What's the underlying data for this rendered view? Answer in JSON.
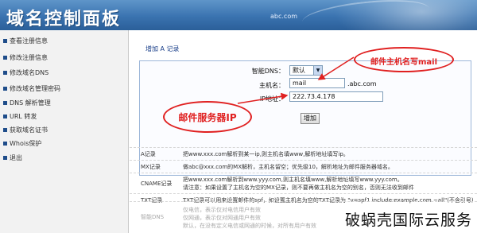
{
  "header": {
    "title": "域名控制面板",
    "site": "abc.com"
  },
  "sidebar": {
    "items": [
      {
        "label": "查看注册信息"
      },
      {
        "label": "修改注册信息"
      },
      {
        "label": "修改域名DNS"
      },
      {
        "label": "修改域名管理密码"
      },
      {
        "label": "DNS 解析管理"
      },
      {
        "label": "URL 转发"
      },
      {
        "label": "获取域名证书"
      },
      {
        "label": "Whois保护"
      },
      {
        "label": "退出"
      }
    ],
    "bullet_color": "#1f4d8a"
  },
  "main": {
    "tab_title": "增加 A 记录",
    "form": {
      "line_label": "智能DNS：",
      "line_value": "默认",
      "host_label": "主机名：",
      "host_value": "mail",
      "host_suffix": ".abc.com",
      "ip_label": "IP地址：",
      "ip_value": "222.73.4.178",
      "submit_label": "增加"
    },
    "annotations": {
      "host_note": "邮件主机名写mail",
      "ip_note": "邮件服务器IP",
      "color": "#e02020"
    },
    "records": [
      {
        "key": "A记录",
        "lines": [
          "把www.xxx.com解析到某一ip,则主机名填www,解析地址填写ip。"
        ]
      },
      {
        "key": "MX记录",
        "lines": [
          "做abc@xxx.com的MX解析，主机名留空；优先级10，解析地址为邮件服务器域名。"
        ]
      },
      {
        "key": "CNAME记录",
        "lines": [
          "把www.xxx.com解析到www.yyy.com,则主机名填www,解析地址填写www.yyy.com。",
          "请注意：如果设置了主机名为空的MX记录，则不要再做主机名为空的别名，否则无法收到邮件"
        ]
      },
      {
        "key": "TXT记录",
        "lines": [
          "TXT记录可以用来设置邮件的spf，如设置主机名为空的TXT记录为 \"v=spf1 include:example.com ~all\"(不含引号)"
        ]
      },
      {
        "key": "智能DNS",
        "lines": [
          "仅电信，表示仅对电信用户有效",
          "仅网通，表示仅对网通用户有效",
          "默认，在没有定义电信或网通的时候，对所有用户有效"
        ]
      }
    ]
  },
  "watermark": "破蜗壳国际云服务"
}
